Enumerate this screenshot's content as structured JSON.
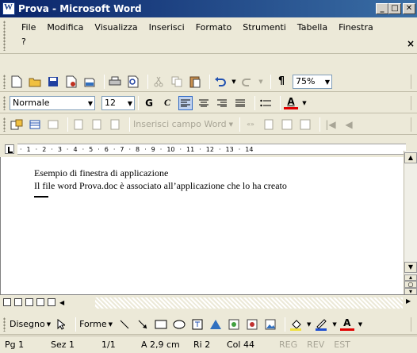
{
  "window": {
    "title": "Prova - Microsoft Word"
  },
  "menu": {
    "items": [
      "File",
      "Modifica",
      "Visualizza",
      "Inserisci",
      "Formato",
      "Strumenti",
      "Tabella",
      "Finestra"
    ],
    "help": "?",
    "close_doc": "×"
  },
  "standard_toolbar": {
    "zoom": "75%",
    "icons": [
      "new-icon",
      "open-icon",
      "save-icon",
      "permission-icon",
      "email-icon",
      "print-icon",
      "print-preview-icon",
      "cut-icon",
      "copy-icon",
      "paste-icon",
      "undo-icon",
      "redo-icon",
      "pilcrow-icon"
    ]
  },
  "format_toolbar": {
    "style": "Normale",
    "size": "12",
    "bold": "G",
    "italic": "C",
    "underline": "S",
    "font_color": "A"
  },
  "forms_toolbar": {
    "insert_field": "Inserisci campo Word"
  },
  "ruler": {
    "marks": [
      "1",
      "2",
      "3",
      "4",
      "5",
      "6",
      "7",
      "8",
      "9",
      "10",
      "11",
      "12",
      "13",
      "14"
    ]
  },
  "document": {
    "lines": [
      "Esempio di finestra di applicazione",
      "Il file word Prova.doc è associato all’applicazione che lo ha creato"
    ]
  },
  "drawing_toolbar": {
    "draw": "Disegno",
    "shapes": "Forme"
  },
  "status": {
    "page": "Pg 1",
    "section": "Sez 1",
    "pages": "1/1",
    "at": "A 2,9 cm",
    "line": "Ri 2",
    "col": "Col 44",
    "rec": "REG",
    "rev": "REV",
    "ext": "EST"
  }
}
